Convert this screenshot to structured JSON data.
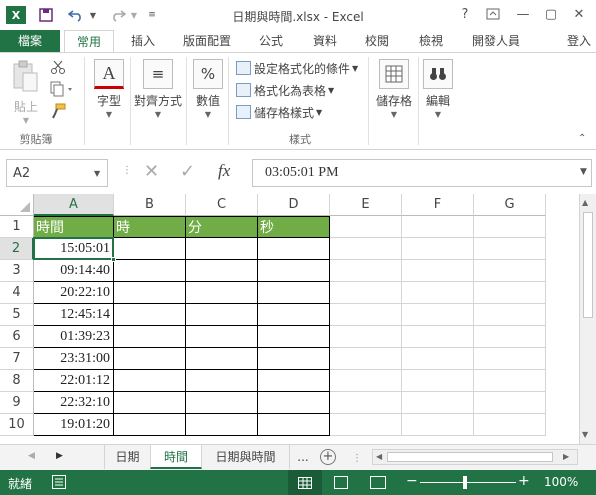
{
  "window": {
    "title": "日期與時間.xlsx - Excel",
    "help": "?",
    "minimize": "—",
    "restore": "▢",
    "close": "✕"
  },
  "tabs": [
    {
      "label": "檔案"
    },
    {
      "label": "常用"
    },
    {
      "label": "插入"
    },
    {
      "label": "版面配置"
    },
    {
      "label": "公式"
    },
    {
      "label": "資料"
    },
    {
      "label": "校閱"
    },
    {
      "label": "檢視"
    },
    {
      "label": "開發人員"
    }
  ],
  "signin": "登入",
  "ribbon": {
    "paste": "貼上",
    "clipboard_group": "剪貼簿",
    "font": "字型",
    "align": "對齊方式",
    "number": "數值",
    "number_symbol": "%",
    "cond_format": "設定格式化的條件",
    "format_table": "格式化為表格",
    "cell_styles": "儲存格樣式",
    "styles_group": "樣式",
    "cells": "儲存格",
    "editing": "編輯"
  },
  "formula_bar": {
    "name_box": "A2",
    "fx": "fx",
    "value": "03:05:01 PM"
  },
  "columns": [
    "A",
    "B",
    "C",
    "D",
    "E",
    "F",
    "G"
  ],
  "rows": [
    "1",
    "2",
    "3",
    "4",
    "5",
    "6",
    "7",
    "8",
    "9",
    "10"
  ],
  "headers": [
    "時間",
    "時",
    "分",
    "秒"
  ],
  "times": [
    "15:05:01",
    "09:14:40",
    "20:22:10",
    "12:45:14",
    "01:39:23",
    "23:31:00",
    "22:01:12",
    "22:32:10",
    "19:01:20"
  ],
  "sheets": [
    "日期",
    "時間",
    "日期與時間"
  ],
  "sheet_more": "...",
  "status": {
    "ready": "就緒",
    "zoom": "100%"
  },
  "colors": {
    "accent": "#217346",
    "header_fill": "#70ad47"
  }
}
